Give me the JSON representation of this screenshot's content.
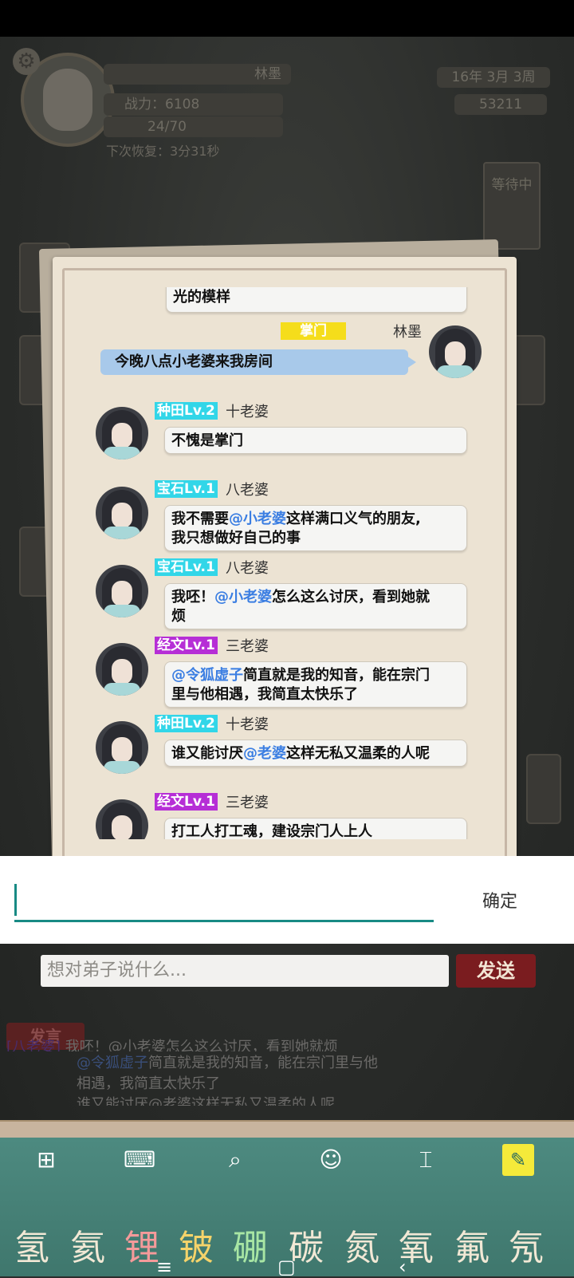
{
  "hud": {
    "player_name": "林墨",
    "power": "战力：6108",
    "stamina": "24/70",
    "recover": "下次恢复：3分31秒",
    "date": "16年  3月  3周",
    "coins": "53211",
    "waiting": "等待中"
  },
  "chat": {
    "partial_top": "光的模样",
    "me": {
      "rank": "掌门",
      "name": "林墨",
      "text": "今晚八点小老婆来我房间"
    },
    "messages": [
      {
        "tag": "种田Lv.2",
        "name": "十老婆",
        "parts": [
          "不愧是掌门"
        ]
      },
      {
        "tag": "宝石Lv.1",
        "name": "八老婆",
        "line1_pre": "我不需要",
        "line1_mention": "@小老婆",
        "line1_post": "这样满口义气的朋友,",
        "line2": "我只想做好自己的事"
      },
      {
        "tag": "宝石Lv.1",
        "name": "八老婆",
        "line1_pre": "我呸！",
        "line1_mention": "@小老婆",
        "line1_post": "怎么这么讨厌，看到她就",
        "line2": "烦"
      },
      {
        "tag": "经文Lv.1",
        "name": "三老婆",
        "line1_mention": "@令狐虚子",
        "line1_post": "简直就是我的知音，能在宗门",
        "line2": "里与他相遇，我简直太快乐了"
      },
      {
        "tag": "种田Lv.2",
        "name": "十老婆",
        "line1_pre": "谁又能讨厌",
        "line1_mention": "@老婆",
        "line1_post": "这样无私又温柔的人呢"
      },
      {
        "tag": "经文Lv.1",
        "name": "三老婆",
        "line1_pre": "打工人打工魂，建设宗门人上人"
      }
    ]
  },
  "popup": {
    "value": "",
    "confirm": "确定"
  },
  "composer": {
    "placeholder": "想对弟子说什么...",
    "send": "发送",
    "speak": "发言"
  },
  "log": {
    "line1_who": "[八老婆]",
    "line1": "我呸！@小老婆怎么这么讨厌，看到她就烦",
    "line2_mention": "@令狐虚子",
    "line2_text": "简直就是我的知音，能在宗门里与他",
    "line3": "相遇，我简直太快乐了",
    "line4": "谁又能讨厌@老婆这样无私又温柔的人呢"
  },
  "keyboard": {
    "candidates": [
      "氢",
      "氦",
      "锂",
      "铍",
      "硼",
      "碳",
      "氮",
      "氧",
      "氟",
      "氖"
    ],
    "colors": {
      "bg": "#4d8a80",
      "accent": "#f5ea3a"
    }
  }
}
